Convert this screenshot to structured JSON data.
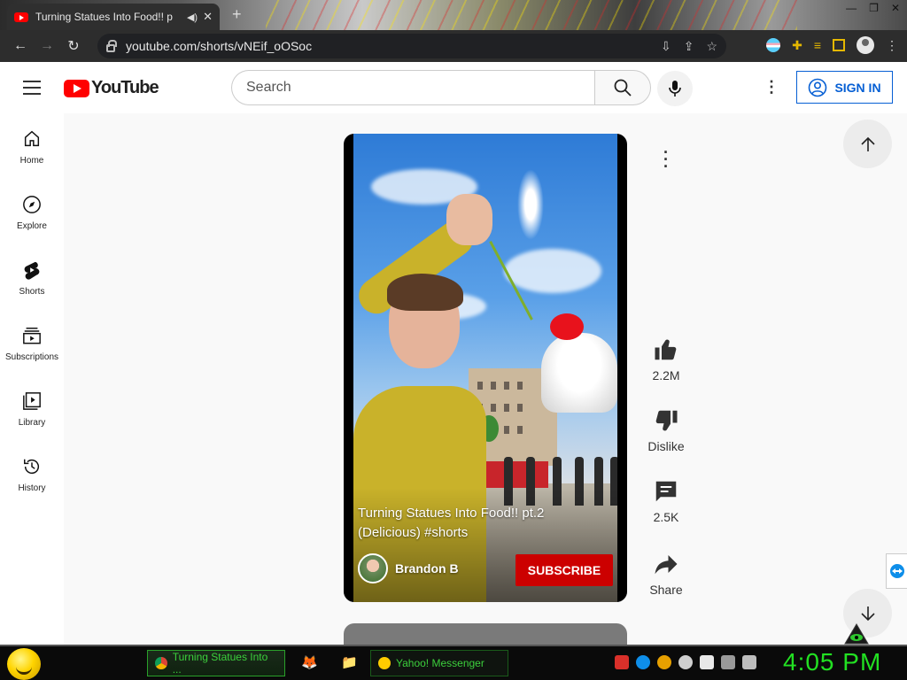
{
  "browser": {
    "tab_title": "Turning Statues Into Food!! p",
    "new_tab": "+",
    "url": "youtube.com/shorts/vNEif_oOSoc"
  },
  "header": {
    "logo_text": "YouTube",
    "search_placeholder": "Search",
    "sign_in": "SIGN IN"
  },
  "sidebar": {
    "items": [
      {
        "label": "Home",
        "icon": "home-icon"
      },
      {
        "label": "Explore",
        "icon": "compass-icon"
      },
      {
        "label": "Shorts",
        "icon": "shorts-icon"
      },
      {
        "label": "Subscriptions",
        "icon": "subscriptions-icon"
      },
      {
        "label": "Library",
        "icon": "library-icon"
      },
      {
        "label": "History",
        "icon": "history-icon"
      }
    ]
  },
  "short": {
    "title": "Turning Statues Into Food!! pt.2 (Delicious) #shorts",
    "channel": "Brandon B",
    "subscribe": "SUBSCRIBE"
  },
  "actions": {
    "likes": "2.2M",
    "dislike": "Dislike",
    "comments": "2.5K",
    "share": "Share"
  },
  "taskbar": {
    "chrome_window": "Turning Statues Into ...",
    "yahoo_window": "Yahoo! Messenger",
    "clock": "4:05 PM"
  },
  "colors": {
    "yt_red": "#ff0000",
    "subscribe_red": "#cc0000",
    "link_blue": "#065fd4",
    "clock_green": "#22e022"
  }
}
